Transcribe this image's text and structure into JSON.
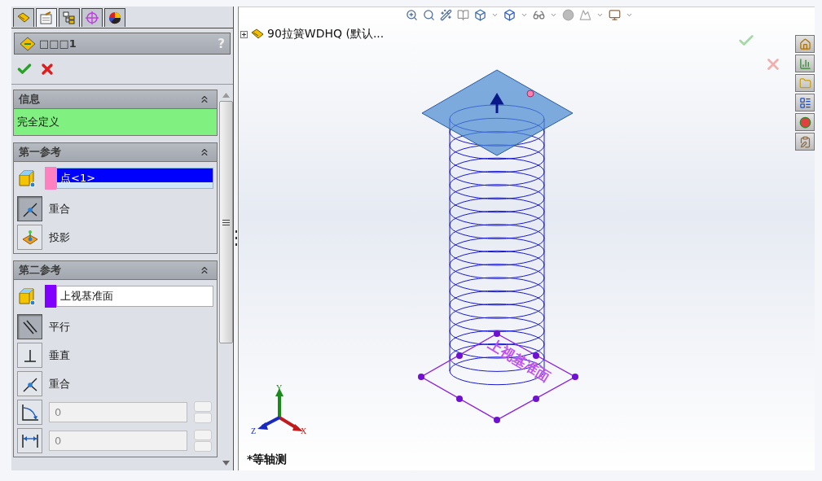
{
  "panel_tabs": [
    {
      "kind": "feature",
      "selected": false
    },
    {
      "kind": "property",
      "selected": true
    },
    {
      "kind": "config",
      "selected": false
    },
    {
      "kind": "dimxpert",
      "selected": false
    },
    {
      "kind": "display",
      "selected": false
    }
  ],
  "property_manager": {
    "title": "□□□1",
    "help": "?"
  },
  "info": {
    "title": "信息",
    "message": "完全定义"
  },
  "first_reference": {
    "title": "第一参考",
    "selection": {
      "value": "点<1>",
      "color": "#ff80c0",
      "selected": true
    },
    "constraints": [
      {
        "label": "重合",
        "kind": "coincident",
        "selected": true
      },
      {
        "label": "投影",
        "kind": "project",
        "selected": false
      }
    ]
  },
  "second_reference": {
    "title": "第二参考",
    "selection": {
      "value": "上视基准面",
      "color": "#8000ff",
      "selected": false
    },
    "constraints": [
      {
        "label": "平行",
        "kind": "parallel",
        "selected": true
      },
      {
        "label": "垂直",
        "kind": "perpendicular",
        "selected": false
      },
      {
        "label": "重合",
        "kind": "coincident",
        "selected": false
      }
    ],
    "values": [
      {
        "kind": "angle",
        "value": "0",
        "disabled": true
      },
      {
        "kind": "distance",
        "value": "0",
        "disabled": true
      }
    ]
  },
  "viewport": {
    "tree_root": "90拉簧WDHQ (默认...",
    "plane_label": "上视基准面",
    "axes": {
      "x": "X",
      "y": "Y",
      "z": "Z"
    },
    "view_name": "*等轴测"
  }
}
